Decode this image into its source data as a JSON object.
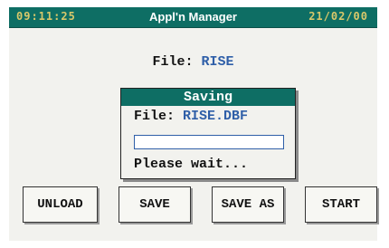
{
  "header": {
    "time": "09:11:25",
    "title": "Appl'n Manager",
    "date": "21/02/00"
  },
  "main": {
    "file_label": "File:",
    "file_name": "RISE"
  },
  "dialog": {
    "title": "Saving",
    "file_label": "File:",
    "file_name": "RISE.DBF",
    "progress": 0,
    "message": "Please wait..."
  },
  "buttons": [
    {
      "label": "UNLOAD"
    },
    {
      "label": "SAVE"
    },
    {
      "label": "SAVE AS"
    },
    {
      "label": "START"
    }
  ],
  "colors": {
    "titlebar": "#0e6e64",
    "accent_text": "#2f5fa8",
    "clock_text": "#d9c86a"
  }
}
